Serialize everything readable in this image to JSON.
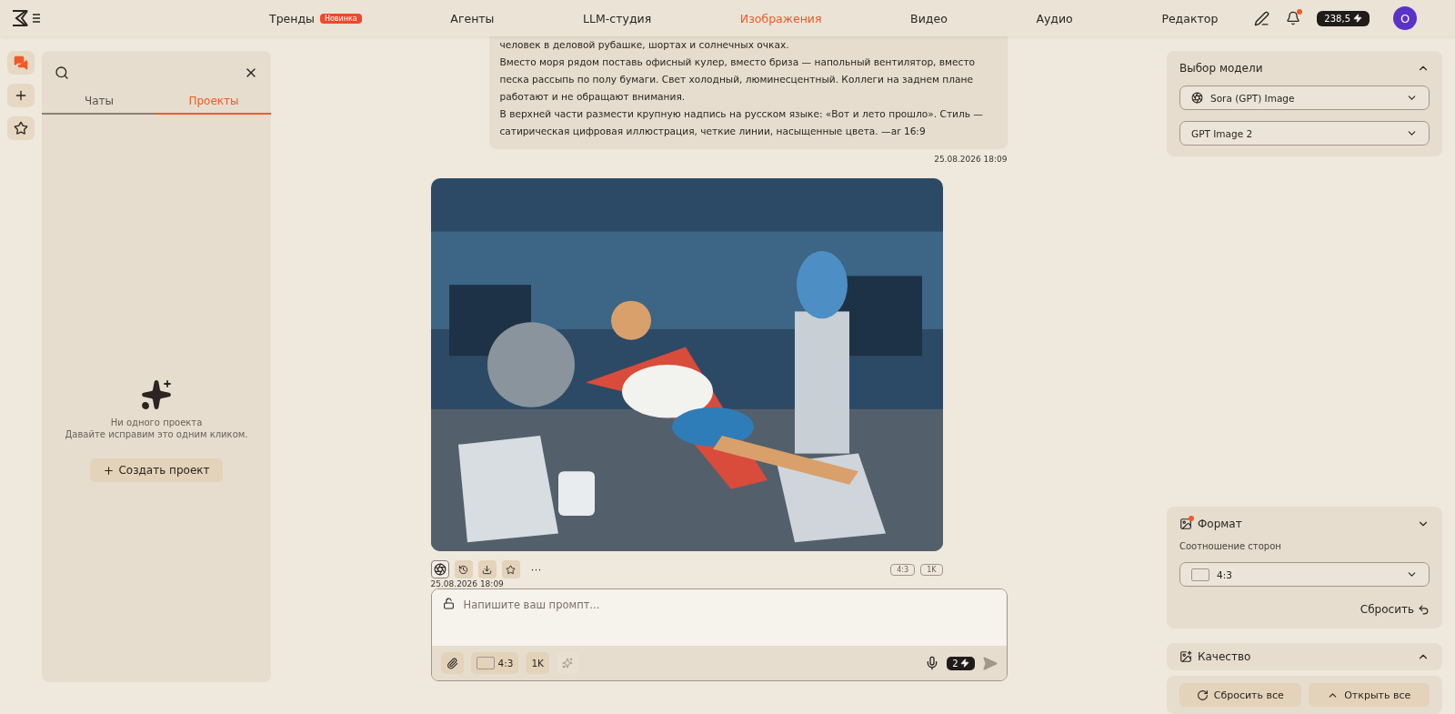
{
  "header": {
    "nav": [
      {
        "label": "Тренды",
        "badge": "Новинка",
        "selected": false
      },
      {
        "label": "Агенты",
        "selected": false
      },
      {
        "label": "LLM-студия",
        "selected": false
      },
      {
        "label": "Изображения",
        "selected": true
      },
      {
        "label": "Видео",
        "selected": false
      },
      {
        "label": "Аудио",
        "selected": false
      },
      {
        "label": "Редактор",
        "selected": false
      }
    ],
    "notification": true,
    "balance": "238,5",
    "avatar": "O"
  },
  "rail": [
    {
      "kind": "chats",
      "selected": true
    },
    {
      "kind": "new",
      "selected": false
    },
    {
      "kind": "favorites",
      "selected": false
    }
  ],
  "sidebar": {
    "tabs": [
      {
        "label": "Чаты",
        "selected": false
      },
      {
        "label": "Проекты",
        "selected": true
      }
    ],
    "empty_title": "Ни одного проекта",
    "empty_text": "Давайте исправим это одним кликом.",
    "create_button": "Создать проект"
  },
  "chat": {
    "prompt": [
      "человек в деловой рубашке, шортах и солнечных очках.",
      "Вместо моря рядом поставь офисный кулер, вместо бриза — напольный вентилятор, вместо песка рассыпь по полу бумаги. Свет холодный, люминесцентный. Коллеги на заднем плане работают и не обращают внимания.",
      "В верхней части размести крупную надпись на русском языке: «Вот и лето прошло». Стиль — сатирическая цифровая иллюстрация, четкие линии, насыщенные цвета. —ar 16:9"
    ],
    "prompt_time": "25.08.2026 18:09",
    "result": {
      "kind": "picture",
      "more": "···",
      "tags": [
        "4:3",
        "1K"
      ],
      "time": "25.08.2026 18:09"
    }
  },
  "composer": {
    "placeholder": "Напишите ваш промпт...",
    "ratio": "4:3",
    "resolution": "1K",
    "cost": "2"
  },
  "settings": {
    "model": {
      "title": "Выбор модели",
      "expanded": true,
      "provider": "Sora (GPT) Image",
      "version": "GPT Image 2"
    },
    "format": {
      "title": "Формат",
      "expanded": true,
      "changed": true,
      "ratio_label": "Соотношение сторон",
      "ratio": "4:3",
      "reset": "Сбросить"
    },
    "quality": {
      "title": "Качество",
      "expanded": false
    },
    "reset_all": "Сбросить все",
    "open_all": "Открыть все"
  }
}
